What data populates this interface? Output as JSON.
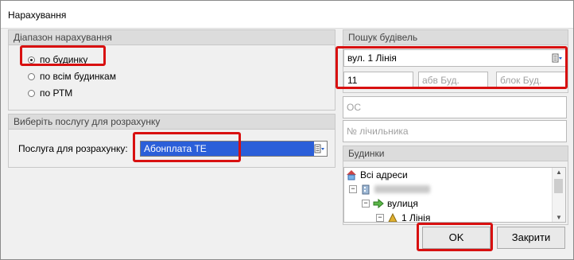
{
  "window": {
    "title": "Нарахування"
  },
  "range_group": {
    "header": "Діапазон нарахування",
    "options": [
      {
        "label": "по будинку",
        "selected": true
      },
      {
        "label": "по всім будинкам",
        "selected": false
      },
      {
        "label": "по РТМ",
        "selected": false
      }
    ]
  },
  "service_group": {
    "header": "Виберіть послугу для розрахунку",
    "label": "Послуга для розрахунку:",
    "value": "Абонплата ТЕ"
  },
  "search_group": {
    "header": "Пошук будівель",
    "street_value": "вул. 1 Лінія",
    "house_number": "11",
    "house_letter_placeholder": "абв Буд.",
    "block_placeholder": "блок Буд.",
    "os_placeholder": "ОС",
    "meter_placeholder": "№ лічильника"
  },
  "buildings_group": {
    "header": "Будинки",
    "tree": [
      {
        "label": "Всі адреси",
        "level": 0,
        "icon": "house-icon"
      },
      {
        "label": "",
        "level": 1,
        "icon": "city-icon",
        "redacted": true
      },
      {
        "label": "вулиця",
        "level": 2,
        "icon": "arrow-right-icon"
      },
      {
        "label": "1 Лінія",
        "level": 3,
        "icon": "street-icon"
      }
    ]
  },
  "buttons": {
    "ok": "OK",
    "cancel": "Закрити"
  },
  "colors": {
    "highlight": "#d81010",
    "selection": "#2b5fd9",
    "header_bg": "#dcdcdc"
  }
}
